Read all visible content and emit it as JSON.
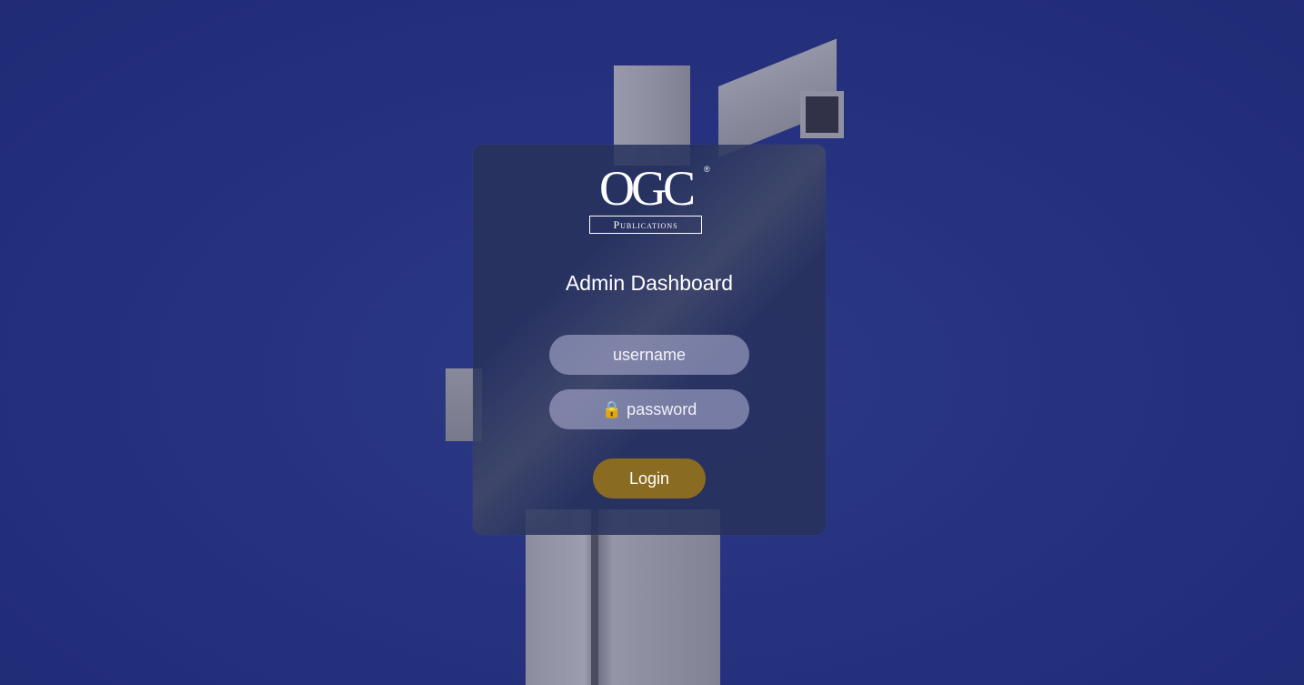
{
  "logo": {
    "letters": "OGC",
    "registered": "®",
    "subtitle": "Publications"
  },
  "login": {
    "title": "Admin Dashboard",
    "username_placeholder": "username",
    "password_placeholder": "🔒 password",
    "submit_label": "Login"
  },
  "colors": {
    "background": "#2c3a86",
    "card": "#28325c",
    "input": "#a8aacd",
    "button": "#8a6b22"
  }
}
